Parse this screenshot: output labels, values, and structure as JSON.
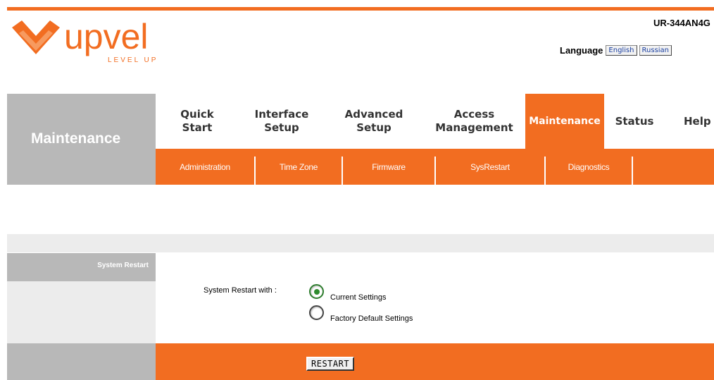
{
  "header": {
    "logo_text": "upvel",
    "logo_tagline": "LEVEL UP",
    "model": "UR-344AN4G",
    "language_label": "Language",
    "languages": [
      "English",
      "Russian"
    ]
  },
  "section_title": "Maintenance",
  "nav": {
    "items": [
      {
        "line1": "Quick",
        "line2": "Start"
      },
      {
        "line1": "Interface",
        "line2": "Setup"
      },
      {
        "line1": "Advanced",
        "line2": "Setup"
      },
      {
        "line1": "Access",
        "line2": "Management"
      },
      {
        "line1": "Maintenance",
        "line2": ""
      },
      {
        "line1": "Status",
        "line2": ""
      },
      {
        "line1": "Help",
        "line2": ""
      }
    ],
    "active": "Maintenance"
  },
  "subnav": {
    "items": [
      "Administration",
      "Time Zone",
      "Firmware",
      "SysRestart",
      "Diagnostics"
    ],
    "active": "SysRestart"
  },
  "restart": {
    "section_label": "System Restart",
    "with_label": "System Restart with :",
    "options": [
      {
        "label": "Current Settings",
        "checked": true
      },
      {
        "label": "Factory Default Settings",
        "checked": false
      }
    ],
    "button_label": "RESTART"
  },
  "colors": {
    "accent": "#f26d21",
    "grey": "#b8b8b8",
    "light_grey": "#ececec",
    "radio_checked": "#2e8b2e"
  }
}
